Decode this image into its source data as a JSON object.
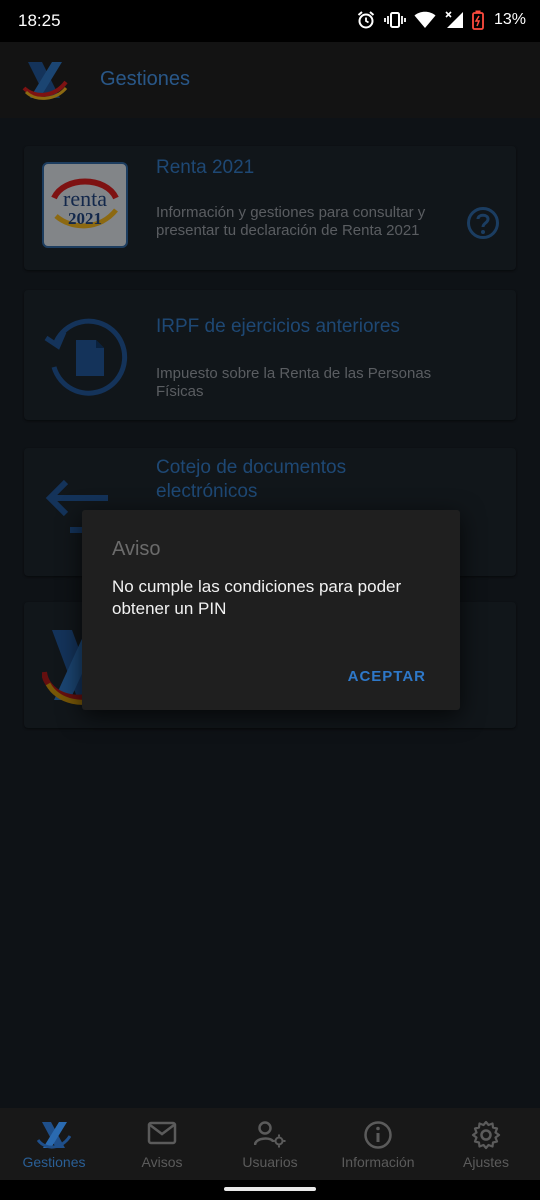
{
  "status_bar": {
    "time": "18:25",
    "battery": "13%"
  },
  "app_bar": {
    "title": "Gestiones"
  },
  "cards": [
    {
      "title": "Renta 2021",
      "description": "Información y gestiones para consultar y presentar tu declaración de Renta 2021",
      "logo_text_1": "renta",
      "logo_text_2": "2021"
    },
    {
      "title": "IRPF de ejercicios anteriores",
      "description": "Impuesto sobre la Renta de las Personas Físicas"
    },
    {
      "title": "Cotejo de documentos electrónicos",
      "description": ""
    }
  ],
  "dialog": {
    "title": "Aviso",
    "message": "No cumple las condiciones para poder obtener un PIN",
    "button": "ACEPTAR"
  },
  "bottom_nav": [
    {
      "label": "Gestiones",
      "icon": "agencia-logo-icon",
      "active": true
    },
    {
      "label": "Avisos",
      "icon": "mail-icon",
      "active": false
    },
    {
      "label": "Usuarios",
      "icon": "user-settings-icon",
      "active": false
    },
    {
      "label": "Información",
      "icon": "info-icon",
      "active": false
    },
    {
      "label": "Ajustes",
      "icon": "gear-icon",
      "active": false
    }
  ],
  "colors": {
    "accent": "#3f86d1",
    "dialog_button": "#2e78c8",
    "background": "#121212"
  }
}
